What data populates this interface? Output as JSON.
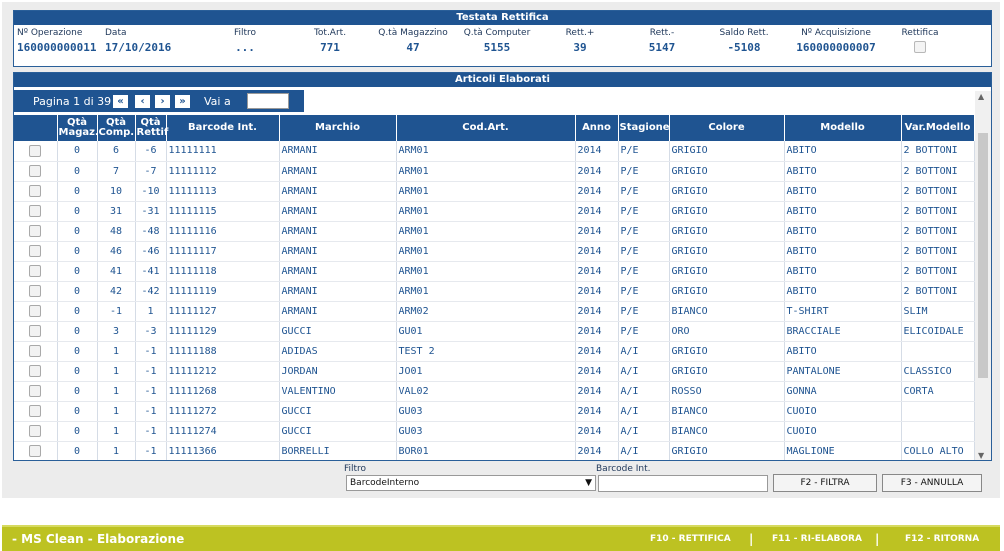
{
  "header": {
    "title": "Testata Rettifica",
    "fields": [
      {
        "label": "Nº Operazione",
        "value": "160000000011"
      },
      {
        "label": "Data",
        "value": "17/10/2016"
      },
      {
        "label": "Filtro",
        "value": "..."
      },
      {
        "label": "Tot.Art.",
        "value": "771"
      },
      {
        "label": "Q.tà Magazzino",
        "value": "47"
      },
      {
        "label": "Q.tà Computer",
        "value": "5155"
      },
      {
        "label": "Rett.+",
        "value": "39"
      },
      {
        "label": "Rett.-",
        "value": "5147"
      },
      {
        "label": "Saldo Rett.",
        "value": "-5108"
      },
      {
        "label": "Nº Acquisizione",
        "value": "160000000007"
      },
      {
        "label": "Rettifica",
        "value": ""
      }
    ]
  },
  "articles": {
    "title": "Articoli Elaborati",
    "pager": {
      "label": "Pagina 1 di 39",
      "first": "«",
      "prev": "‹",
      "next": "›",
      "last": "»",
      "goto_label": "Vai a",
      "goto_value": ""
    },
    "columns": [
      "",
      "Qtà Magaz.",
      "Qtà Comp.",
      "Qtà Rettif",
      "Barcode Int.",
      "Marchio",
      "Cod.Art.",
      "Anno",
      "Stagione",
      "Colore",
      "Modello",
      "Var.Modello"
    ],
    "rows": [
      [
        "0",
        "6",
        "-6",
        "11111111",
        "ARMANI",
        "ARM01",
        "2014",
        "P/E",
        "GRIGIO",
        "ABITO",
        "2 BOTTONI"
      ],
      [
        "0",
        "7",
        "-7",
        "11111112",
        "ARMANI",
        "ARM01",
        "2014",
        "P/E",
        "GRIGIO",
        "ABITO",
        "2 BOTTONI"
      ],
      [
        "0",
        "10",
        "-10",
        "11111113",
        "ARMANI",
        "ARM01",
        "2014",
        "P/E",
        "GRIGIO",
        "ABITO",
        "2 BOTTONI"
      ],
      [
        "0",
        "31",
        "-31",
        "11111115",
        "ARMANI",
        "ARM01",
        "2014",
        "P/E",
        "GRIGIO",
        "ABITO",
        "2 BOTTONI"
      ],
      [
        "0",
        "48",
        "-48",
        "11111116",
        "ARMANI",
        "ARM01",
        "2014",
        "P/E",
        "GRIGIO",
        "ABITO",
        "2 BOTTONI"
      ],
      [
        "0",
        "46",
        "-46",
        "11111117",
        "ARMANI",
        "ARM01",
        "2014",
        "P/E",
        "GRIGIO",
        "ABITO",
        "2 BOTTONI"
      ],
      [
        "0",
        "41",
        "-41",
        "11111118",
        "ARMANI",
        "ARM01",
        "2014",
        "P/E",
        "GRIGIO",
        "ABITO",
        "2 BOTTONI"
      ],
      [
        "0",
        "42",
        "-42",
        "11111119",
        "ARMANI",
        "ARM01",
        "2014",
        "P/E",
        "GRIGIO",
        "ABITO",
        "2 BOTTONI"
      ],
      [
        "0",
        "-1",
        "1",
        "11111127",
        "ARMANI",
        "ARM02",
        "2014",
        "P/E",
        "BIANCO",
        "T-SHIRT",
        "SLIM"
      ],
      [
        "0",
        "3",
        "-3",
        "11111129",
        "GUCCI",
        "GU01",
        "2014",
        "P/E",
        "ORO",
        "BRACCIALE",
        "ELICOIDALE"
      ],
      [
        "0",
        "1",
        "-1",
        "11111188",
        "ADIDAS",
        "TEST 2",
        "2014",
        "A/I",
        "GRIGIO",
        "ABITO",
        ""
      ],
      [
        "0",
        "1",
        "-1",
        "11111212",
        "JORDAN",
        "JO01",
        "2014",
        "A/I",
        "GRIGIO",
        "PANTALONE",
        "CLASSICO"
      ],
      [
        "0",
        "1",
        "-1",
        "11111268",
        "VALENTINO",
        "VAL02",
        "2014",
        "A/I",
        "ROSSO",
        "GONNA",
        "CORTA"
      ],
      [
        "0",
        "1",
        "-1",
        "11111272",
        "GUCCI",
        "GU03",
        "2014",
        "A/I",
        "BIANCO",
        "CUOIO",
        ""
      ],
      [
        "0",
        "1",
        "-1",
        "11111274",
        "GUCCI",
        "GU03",
        "2014",
        "A/I",
        "BIANCO",
        "CUOIO",
        ""
      ],
      [
        "0",
        "1",
        "-1",
        "11111366",
        "BORRELLI",
        "BOR01",
        "2014",
        "A/I",
        "GRIGIO",
        "MAGLIONE",
        "COLLO ALTO"
      ]
    ]
  },
  "filter": {
    "filter_label": "Filtro",
    "filter_value": "BarcodeInterno",
    "barcode_label": "Barcode Int.",
    "barcode_value": "",
    "filter_button": "F2 - FILTRA",
    "cancel_button": "F3 - ANNULLA"
  },
  "footer": {
    "title": "- MS Clean - Elaborazione",
    "items": [
      "F10 - RETTIFICA",
      "F11 - RI-ELABORA",
      "F12 - RITORNA"
    ]
  },
  "colors": {
    "primary": "#1f5491",
    "footer": "#bdc222"
  }
}
